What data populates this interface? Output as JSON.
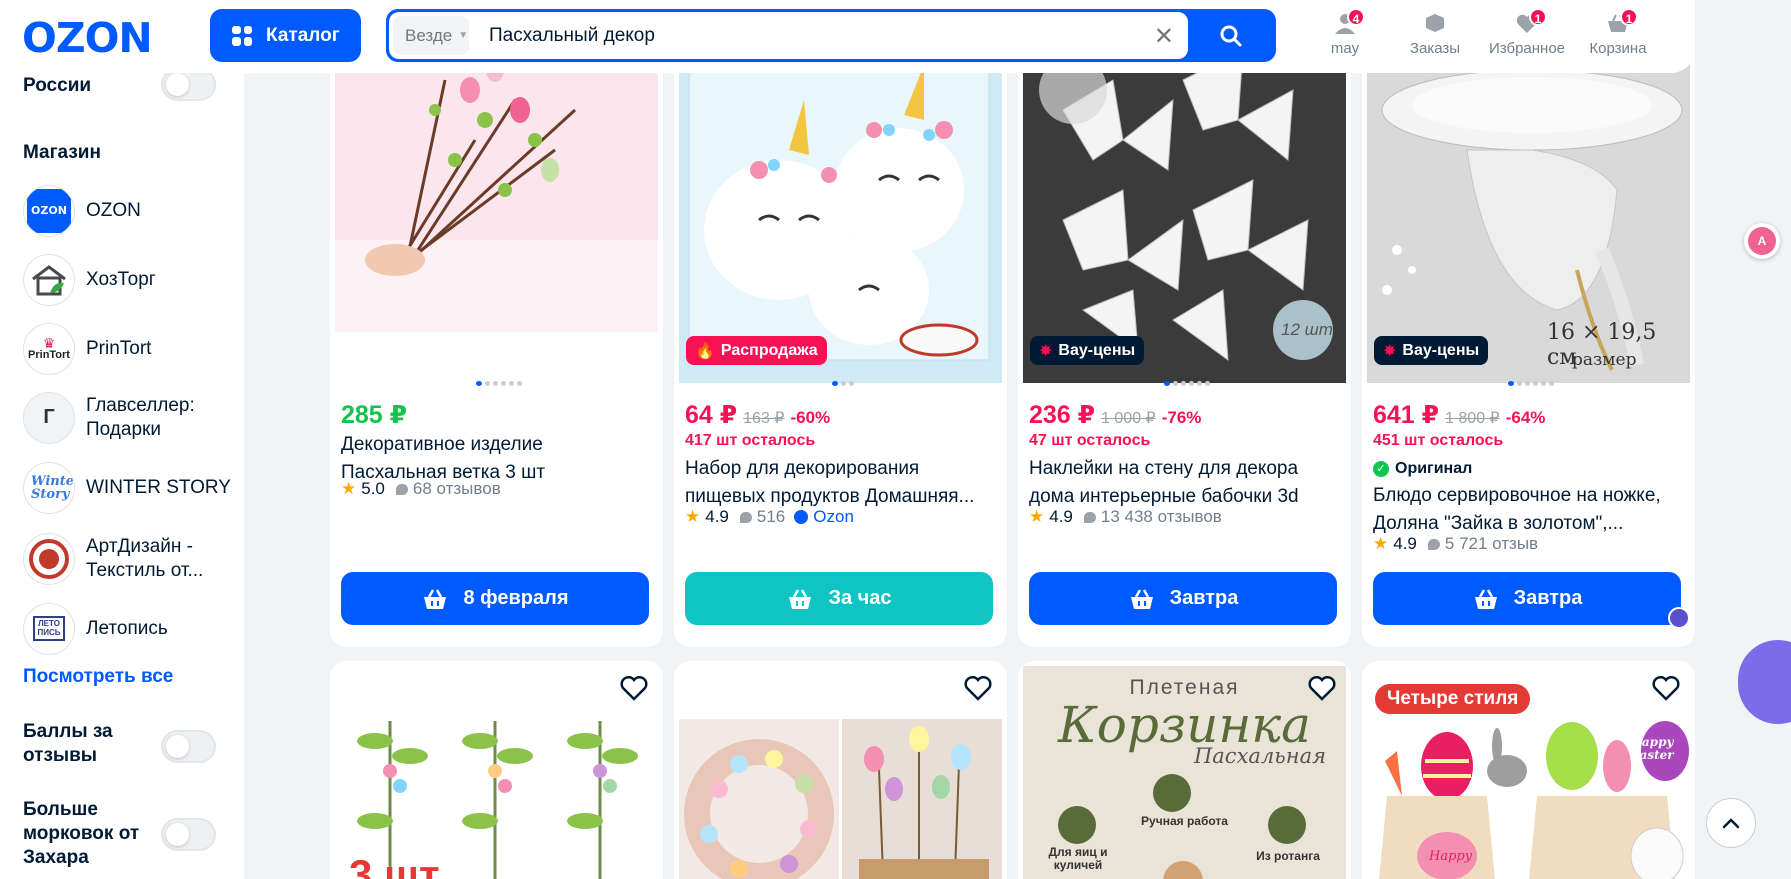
{
  "header": {
    "logo": "OZON",
    "catalog_label": "Каталог",
    "search_scope": "Везде",
    "search_value": "Пасхальный декор",
    "nav": [
      {
        "label": "may",
        "badge": "4"
      },
      {
        "label": "Заказы",
        "badge": ""
      },
      {
        "label": "Избранное",
        "badge": "1"
      },
      {
        "label": "Корзина",
        "badge": "1"
      }
    ]
  },
  "sidebar": {
    "made_in_russia": "Сделано в России",
    "shop_heading": "Магазин",
    "shops": [
      {
        "name": "OZON",
        "logo": "OZON"
      },
      {
        "name": "ХозТорг",
        "logo": "house-logo"
      },
      {
        "name": "PrinTort",
        "logo": "PrinTort"
      },
      {
        "name": "Главселлер: Подарки",
        "logo": "Г"
      },
      {
        "name": "WINTER STORY",
        "logo": "Winter Story"
      },
      {
        "name": "АртДизайн - Текстиль от...",
        "logo": "art-logo"
      },
      {
        "name": "Летопись",
        "logo": "ЛЕТО ПИСЬ"
      }
    ],
    "see_all": "Посмотреть все",
    "points_for_reviews": "Баллы за отзывы",
    "more_carrots": "Больше морковок от Захара"
  },
  "products": [
    {
      "price": "285 ₽",
      "title": "Декоративное изделие Пасхальная ветка 3 шт",
      "rating": "5.0",
      "reviews": "68 отзывов",
      "button": "8 февраля",
      "badge": ""
    },
    {
      "price": "64 ₽",
      "old_price": "163 ₽",
      "discount": "-60%",
      "stock": "417 шт осталось",
      "title": "Набор для декорирования пищевых продуктов Домашняя...",
      "rating": "4.9",
      "reviews": "516",
      "seller": "Ozon",
      "button": "За час",
      "badge": "Распродажа"
    },
    {
      "price": "236 ₽",
      "old_price": "1 000 ₽",
      "discount": "-76%",
      "stock": "47 шт осталось",
      "title": "Наклейки на стену для декора дома интерьерные бабочки 3d",
      "rating": "4.9",
      "reviews": "13 438 отзывов",
      "button": "Завтра",
      "badge": "Вау-цены",
      "img_text": "12 шт"
    },
    {
      "price": "641 ₽",
      "old_price": "1 800 ₽",
      "discount": "-64%",
      "stock": "451 шт осталось",
      "original": "Оригинал",
      "title": "Блюдо сервировочное на ножке, Доляна \"Зайка в золотом\",...",
      "rating": "4.9",
      "reviews": "5 721 отзыв",
      "button": "Завтра",
      "badge": "Вау-цены",
      "img_text": "16 × 19,5 см",
      "img_text2": "размер"
    }
  ],
  "row2": [
    {
      "img_text": "3 шт"
    },
    {
      "img_text": ""
    },
    {
      "img_text": "Плетеная",
      "img_text2": "Корзинка",
      "img_text3": "Пасхальная",
      "img_text4": "Ручная работа",
      "img_text5": "Для яиц и куличей",
      "img_text6": "Из ротанга"
    },
    {
      "img_text": "Четыре стиля",
      "img_text2": "Happy Easter",
      "img_text3": "Happy"
    }
  ],
  "colors": {
    "brand": "#005bff",
    "sale": "#f91155",
    "green_price": "#10c44c",
    "teal_button": "#10c4c4"
  }
}
